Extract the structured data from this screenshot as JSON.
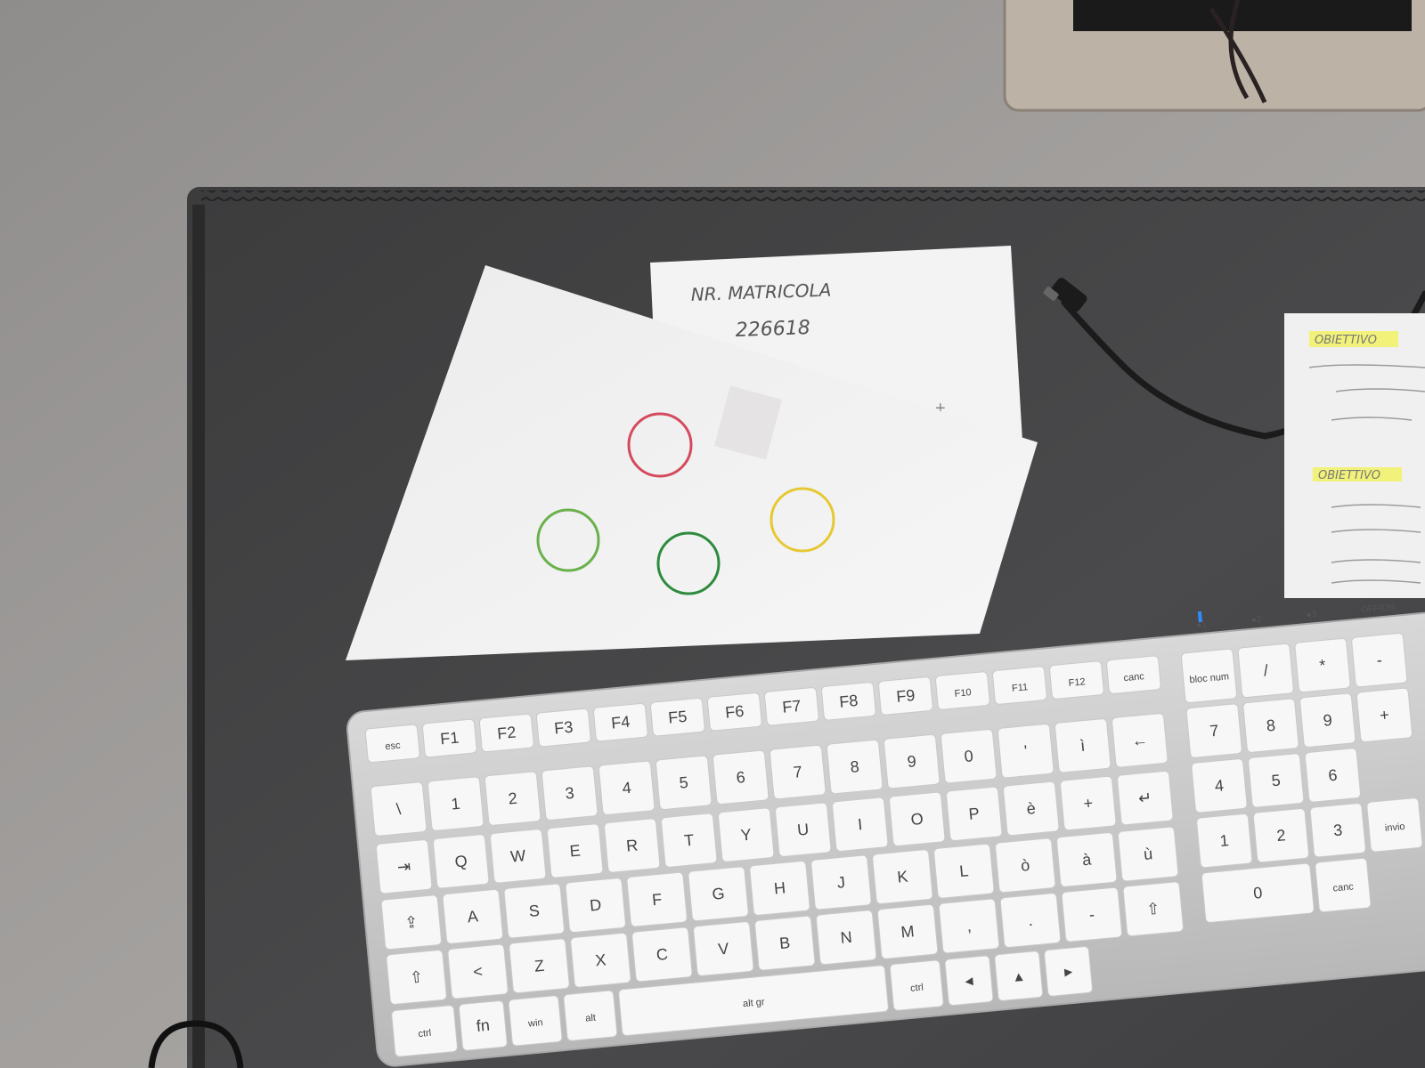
{
  "note": {
    "line1": "NR.  MATRICOLA",
    "line2": "226618"
  },
  "objectives": {
    "header_top": "OBIETTIVO",
    "header_bottom": "OBIETTIVO"
  },
  "circles": [
    {
      "color": "#d44a5c"
    },
    {
      "color": "#6ab04c"
    },
    {
      "color": "#2e8b3e"
    },
    {
      "color": "#e6c832"
    }
  ],
  "keyboard": {
    "rows": [
      [
        "esc",
        "F1",
        "F2",
        "F3",
        "F4",
        "F5",
        "F6",
        "F7",
        "F8",
        "F9",
        "F10",
        "F11",
        "F12",
        "canc"
      ],
      [
        "\\",
        "1",
        "2",
        "3",
        "4",
        "5",
        "6",
        "7",
        "8",
        "9",
        "0",
        "'",
        "ì",
        "←"
      ],
      [
        "⇥",
        "Q",
        "W",
        "E",
        "R",
        "T",
        "Y",
        "U",
        "I",
        "O",
        "P",
        "è",
        "+",
        "↵"
      ],
      [
        "⇪",
        "A",
        "S",
        "D",
        "F",
        "G",
        "H",
        "J",
        "K",
        "L",
        "ò",
        "à",
        "ù"
      ],
      [
        "⇧",
        "<",
        "Z",
        "X",
        "C",
        "V",
        "B",
        "N",
        "M",
        ",",
        ".",
        "-",
        "⇧"
      ],
      [
        "ctrl",
        "fn",
        "win",
        "alt",
        "alt gr",
        "ctrl",
        "◂",
        "▴",
        "▸"
      ]
    ],
    "numpad": [
      [
        "bloc num",
        "/",
        "*",
        "-"
      ],
      [
        "7",
        "8",
        "9",
        "+"
      ],
      [
        "4",
        "5",
        "6"
      ],
      [
        "1",
        "2",
        "3",
        "invio"
      ],
      [
        "0",
        "canc"
      ]
    ],
    "top_labels": [
      "●1",
      "●2",
      "●3",
      "OFF/ON"
    ]
  }
}
